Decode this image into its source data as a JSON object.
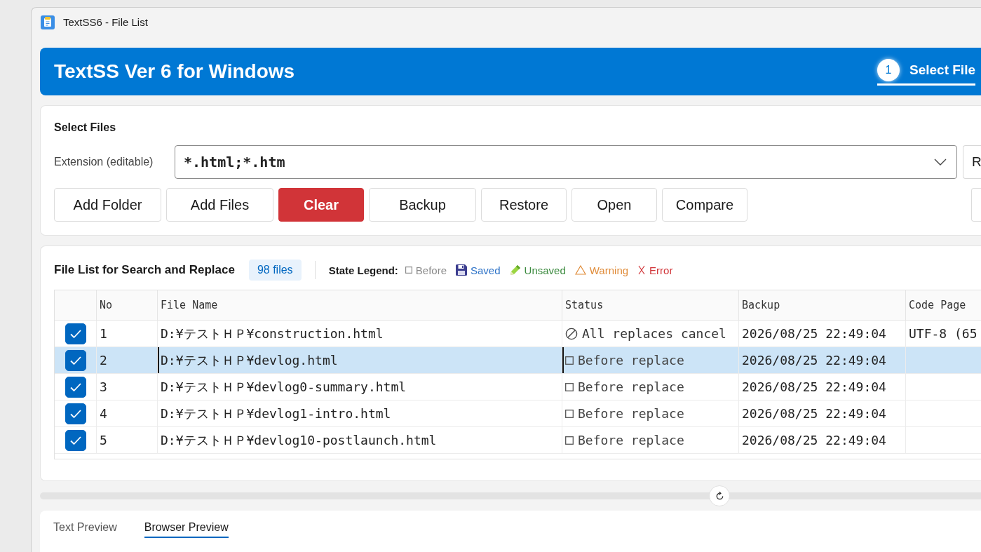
{
  "window": {
    "title": "TextSS6 - File List"
  },
  "header": {
    "title": "TextSS Ver 6 for Windows",
    "steps": [
      {
        "number": "1",
        "label": "Select File",
        "selected": true
      }
    ]
  },
  "select_files": {
    "title": "Select Files",
    "extension": {
      "label": "Extension (editable)",
      "value": "*.html;*.htm"
    },
    "side_button": "R",
    "buttons": [
      {
        "label": "Add Folder",
        "kind": "default"
      },
      {
        "label": "Add Files",
        "kind": "default"
      },
      {
        "label": "Clear",
        "kind": "danger"
      },
      {
        "label": "Backup",
        "kind": "default"
      },
      {
        "label": "Restore",
        "kind": "default"
      },
      {
        "label": "Open",
        "kind": "default"
      },
      {
        "label": "Compare",
        "kind": "default"
      }
    ]
  },
  "file_list": {
    "title": "File List for Search and Replace",
    "count": "98 files",
    "legend": {
      "label": "State Legend:",
      "items": [
        {
          "kind": "before",
          "label": "Before",
          "color": "#8a8a8a"
        },
        {
          "kind": "saved",
          "label": "Saved",
          "color": "#2f74c8"
        },
        {
          "kind": "unsaved",
          "label": "Unsaved",
          "color": "#3d8b40"
        },
        {
          "kind": "warning",
          "label": "Warning",
          "color": "#e08c3a"
        },
        {
          "kind": "error",
          "label": "Error",
          "color": "#d13438"
        }
      ]
    },
    "columns": [
      "No",
      "File Name",
      "Status",
      "Backup",
      "Code Page"
    ],
    "rows": [
      {
        "checked": true,
        "selected": false,
        "focused": false,
        "no": "1",
        "file_name": "D:¥テストＨＰ¥construction.html",
        "status": {
          "kind": "cancelled",
          "text": "All replaces cancel"
        },
        "backup": "2026/08/25 22:49:04",
        "code_page": "UTF-8 (65"
      },
      {
        "checked": true,
        "selected": true,
        "focused": true,
        "no": "2",
        "file_name": "D:¥テストＨＰ¥devlog.html",
        "status": {
          "kind": "before",
          "text": "Before replace"
        },
        "backup": "2026/08/25 22:49:04"
      },
      {
        "checked": true,
        "selected": false,
        "focused": false,
        "no": "3",
        "file_name": "D:¥テストＨＰ¥devlog0-summary.html",
        "status": {
          "kind": "before",
          "text": "Before replace"
        },
        "backup": "2026/08/25 22:49:04"
      },
      {
        "checked": true,
        "selected": false,
        "focused": false,
        "no": "4",
        "file_name": "D:¥テストＨＰ¥devlog1-intro.html",
        "status": {
          "kind": "before",
          "text": "Before replace"
        },
        "backup": "2026/08/25 22:49:04"
      },
      {
        "checked": true,
        "selected": false,
        "focused": false,
        "no": "5",
        "file_name": "D:¥テストＨＰ¥devlog10-postlaunch.html",
        "status": {
          "kind": "before",
          "text": "Before replace"
        },
        "backup": "2026/08/25 22:49:04"
      }
    ]
  },
  "preview_tabs": [
    {
      "label": "Text Preview",
      "selected": false
    },
    {
      "label": "Browser Preview",
      "selected": true
    }
  ]
}
